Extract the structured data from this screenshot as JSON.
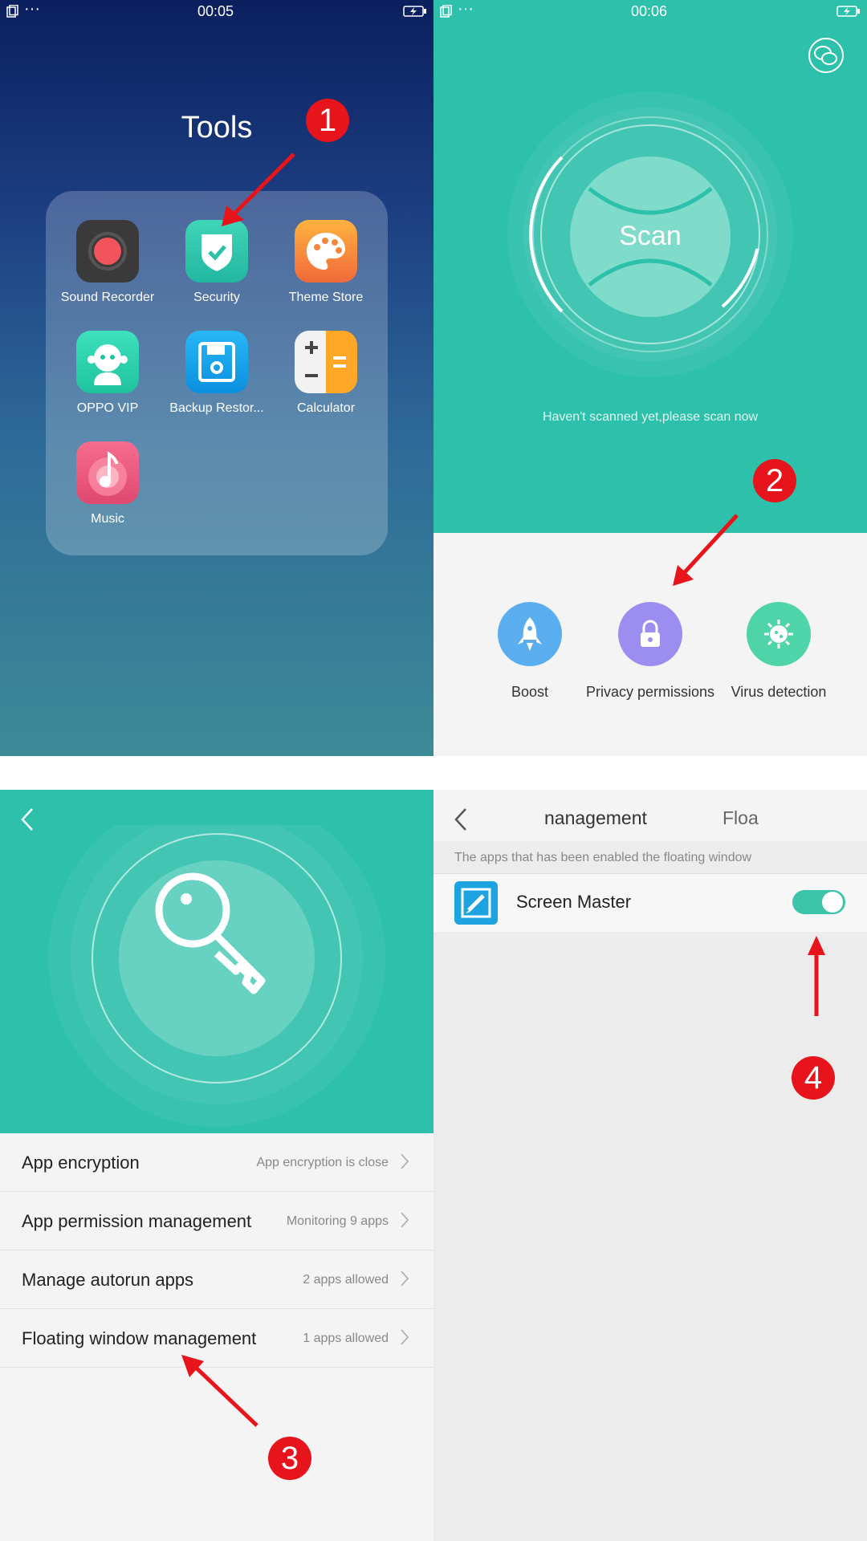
{
  "panel1": {
    "status_time": "00:05",
    "status_dots": "···",
    "folder_title": "Tools",
    "apps": [
      {
        "label": "Sound Recorder",
        "icon": "sound-recorder-icon"
      },
      {
        "label": "Security",
        "icon": "security-shield-icon"
      },
      {
        "label": "Theme Store",
        "icon": "palette-icon"
      },
      {
        "label": "OPPO VIP",
        "icon": "vip-mascot-icon"
      },
      {
        "label": "Backup Restor...",
        "icon": "floppy-disk-icon"
      },
      {
        "label": "Calculator",
        "icon": "calculator-icon"
      },
      {
        "label": "Music",
        "icon": "music-note-icon"
      }
    ],
    "badge": "1"
  },
  "panel2": {
    "status_time": "00:06",
    "status_dots": "···",
    "scan_label": "Scan",
    "scan_status": "Haven't scanned yet,please scan now",
    "features": [
      {
        "label": "Boost",
        "icon": "rocket-icon",
        "color": "#5aaef0"
      },
      {
        "label": "Privacy permissions",
        "icon": "lock-icon",
        "color": "#9b8ef0"
      },
      {
        "label": "Virus detection",
        "icon": "virus-icon",
        "color": "#4fd3a9"
      }
    ],
    "badge": "2"
  },
  "panel3": {
    "rows": [
      {
        "title": "App encryption",
        "value": "App encryption is close"
      },
      {
        "title": "App permission management",
        "value": "Monitoring 9 apps"
      },
      {
        "title": "Manage autorun apps",
        "value": "2 apps allowed"
      },
      {
        "title": "Floating window management",
        "value": "1 apps allowed"
      }
    ],
    "badge": "3"
  },
  "panel4": {
    "tab_partial_1": "nanagement",
    "tab_partial_2": "Floa",
    "section_header": "The apps that has been enabled the floating window",
    "app_name": "Screen Master",
    "toggle_on": true,
    "badge": "4"
  },
  "colors": {
    "teal": "#2dc0ab",
    "annotation_red": "#e8141b"
  }
}
